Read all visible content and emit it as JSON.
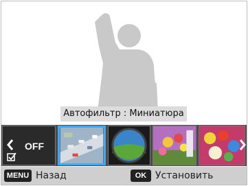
{
  "filter_label": {
    "prefix": "Автофильтр",
    "separator": " : ",
    "value": "Миниатюра"
  },
  "filters": [
    {
      "name": "off",
      "label": "OFF"
    },
    {
      "name": "miniature",
      "selected": true
    },
    {
      "name": "fisheye"
    },
    {
      "name": "vignetting"
    },
    {
      "name": "oil-painting"
    }
  ],
  "bottom_bar": {
    "menu_key": "MENU",
    "back_label": "Назад",
    "ok_key": "OK",
    "set_label": "Установить"
  },
  "colors": {
    "selection_border": "#3fa9f5",
    "strip_background": "#4a4a4a",
    "bottom_bar_background": "#cfcfcf",
    "silhouette": "#c9c9c9"
  },
  "icons": {
    "left_arrow": "chevron-left-icon",
    "right_arrow": "chevron-right-icon",
    "off_check": "check-box-icon"
  }
}
